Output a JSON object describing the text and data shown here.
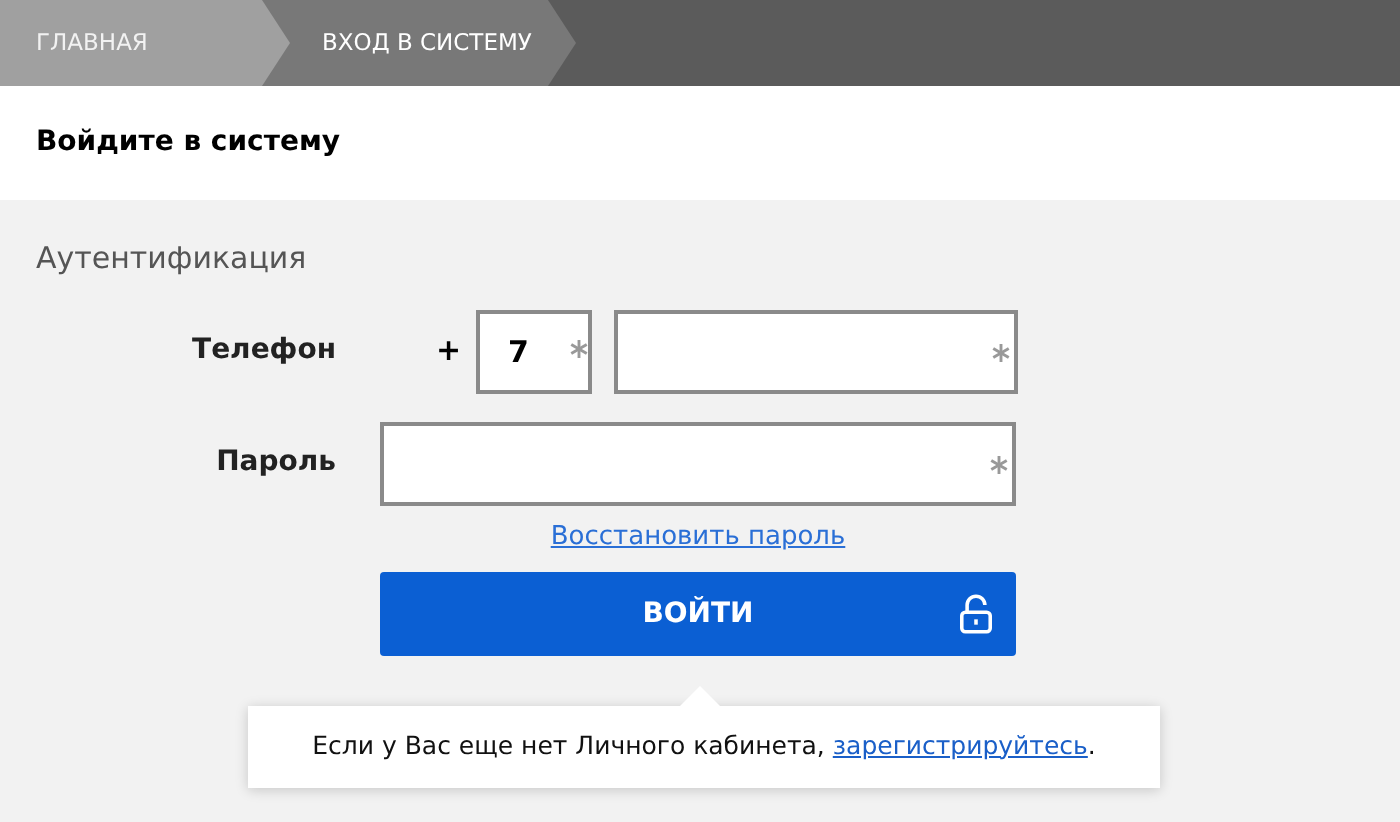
{
  "breadcrumbs": [
    {
      "label": "ГЛАВНАЯ",
      "selected": false
    },
    {
      "label": "ВХОД В СИСТЕМУ",
      "selected": true
    }
  ],
  "page_title": "Войдите в систему",
  "section_title": "Аутентификация",
  "phone": {
    "label": "Телефон",
    "prefix": "+",
    "code": {
      "value": "7",
      "required": true
    },
    "number": {
      "required": true
    }
  },
  "password": {
    "label": "Пароль",
    "required": true
  },
  "restore_link": "Восстановить пароль",
  "login_button": "ВОЙТИ",
  "register_note": {
    "text": "Если у Вас еще нет Личного кабинета, ",
    "link": "зарегистрируйтесь",
    "end": "."
  }
}
